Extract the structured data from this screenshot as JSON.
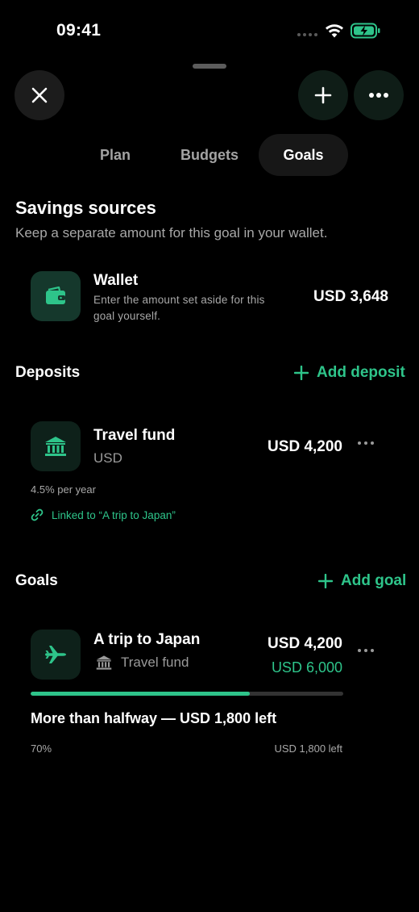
{
  "status_bar": {
    "time": "09:41"
  },
  "tabs": [
    {
      "label": "Plan",
      "active": false
    },
    {
      "label": "Budgets",
      "active": false
    },
    {
      "label": "Goals",
      "active": true
    }
  ],
  "savings": {
    "title": "Savings sources",
    "subtitle": "Keep a separate amount for this goal in your wallet.",
    "wallet": {
      "title": "Wallet",
      "description": "Enter the amount set aside for this goal yourself.",
      "amount": "USD 3,648",
      "icon": "wallet-icon"
    }
  },
  "deposits": {
    "title": "Deposits",
    "add_label": "Add deposit",
    "item": {
      "title": "Travel fund",
      "currency": "USD",
      "amount": "USD 4,200",
      "rate": "4.5% per year",
      "linked": "Linked to “A trip to Japan”",
      "icon": "bank-icon"
    }
  },
  "goals": {
    "title": "Goals",
    "add_label": "Add goal",
    "item": {
      "title": "A trip to Japan",
      "source": "Travel fund",
      "amount": "USD 4,200",
      "target": "USD 6,000",
      "progress": 0.7,
      "status": "More than halfway — USD 1,800 left",
      "percent_label": "70%",
      "left_label": "USD 1,800 left",
      "icon": "airplane-icon"
    }
  },
  "colors": {
    "accent": "#2ec48a",
    "background": "#000000",
    "tile_dark": "#0e211a",
    "tile_wallet": "#15382c"
  }
}
